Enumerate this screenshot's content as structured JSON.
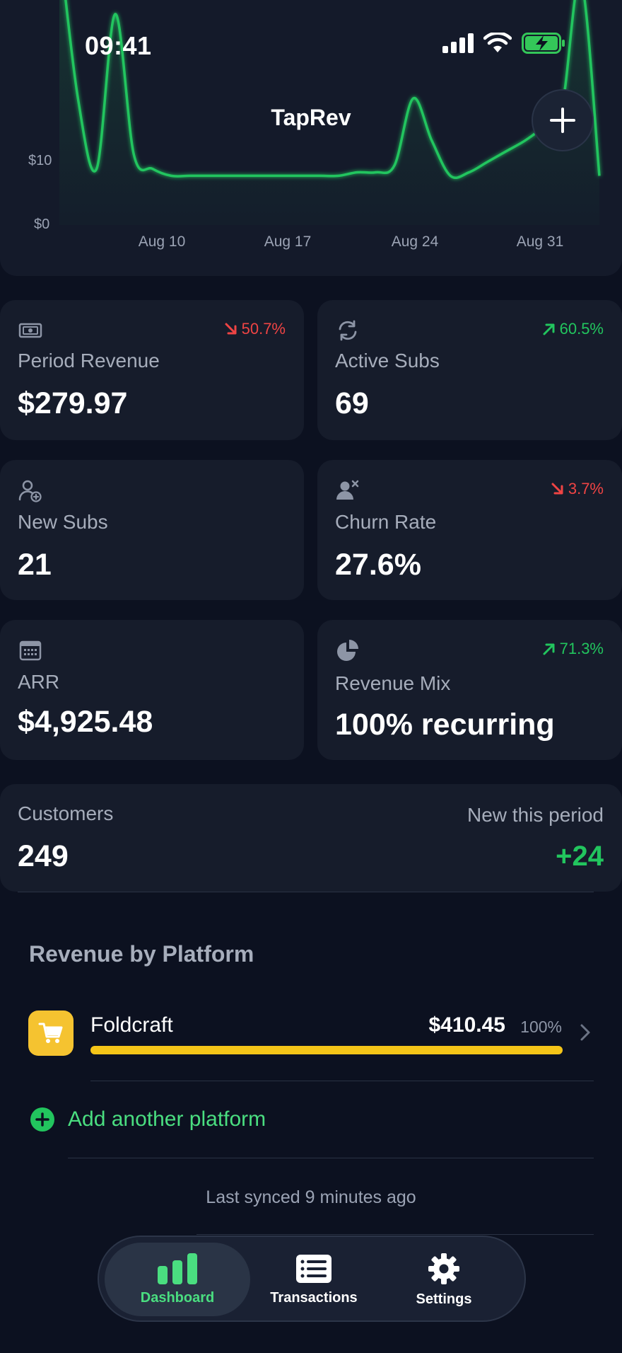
{
  "status_bar": {
    "time": "09:41",
    "icons": [
      "signal-icon",
      "wifi-icon",
      "battery-charging-icon"
    ]
  },
  "header": {
    "title": "TapRev",
    "add_icon": "plus-icon"
  },
  "chart_data": {
    "type": "area",
    "y_tick_labels": [
      "$0",
      "$10"
    ],
    "x_tick_labels": [
      "Aug 10",
      "Aug 17",
      "Aug 24",
      "Aug 31"
    ],
    "x": [
      "Aug 4",
      "Aug 5",
      "Aug 6",
      "Aug 7",
      "Aug 8",
      "Aug 9",
      "Aug 10",
      "Aug 11",
      "Aug 12",
      "Aug 13",
      "Aug 14",
      "Aug 15",
      "Aug 16",
      "Aug 17",
      "Aug 18",
      "Aug 19",
      "Aug 20",
      "Aug 21",
      "Aug 22",
      "Aug 23",
      "Aug 24",
      "Aug 25",
      "Aug 26",
      "Aug 27",
      "Aug 28",
      "Aug 29",
      "Aug 30",
      "Aug 31",
      "Sep 1",
      "Sep 2"
    ],
    "values": [
      40,
      18,
      8,
      30,
      10,
      8,
      7,
      7,
      7,
      7,
      7,
      7,
      7,
      7,
      7,
      7,
      7.5,
      7.5,
      8.5,
      18,
      12,
      7,
      7.5,
      9,
      10.5,
      12,
      14,
      17,
      35,
      7
    ],
    "ylim": [
      0,
      32
    ],
    "color": "#22c55e",
    "grid": false
  },
  "metrics": {
    "period_revenue": {
      "icon": "cash-icon",
      "change": "50.7%",
      "direction": "down",
      "label": "Period Revenue",
      "value": "$279.97"
    },
    "active_subs": {
      "icon": "refresh-icon",
      "change": "60.5%",
      "direction": "up",
      "label": "Active Subs",
      "value": "69"
    },
    "new_subs": {
      "icon": "user-add-icon",
      "label": "New Subs",
      "value": "21"
    },
    "churn_rate": {
      "icon": "user-remove-icon",
      "change": "3.7%",
      "direction": "down",
      "label": "Churn Rate",
      "value": "27.6%"
    },
    "arr": {
      "icon": "calendar-icon",
      "label": "ARR",
      "value": "$4,925.48"
    },
    "revenue_mix": {
      "icon": "pie-chart-icon",
      "change": "71.3%",
      "direction": "up",
      "label": "Revenue Mix",
      "value": "100% recurring"
    }
  },
  "customers": {
    "label": "Customers",
    "value": "249",
    "new_label": "New this period",
    "new_value": "+24"
  },
  "platforms": {
    "title": "Revenue by Platform",
    "items": [
      {
        "icon": "shopping-cart-icon",
        "name": "Foldcraft",
        "amount": "$410.45",
        "percent": "100%",
        "share": 1.0,
        "color": "#f5c518"
      }
    ],
    "add_label": "Add another platform"
  },
  "sync": {
    "text": "Last synced 9 minutes ago"
  },
  "tabs": [
    {
      "label": "Dashboard",
      "icon": "bar-chart-icon",
      "active": true
    },
    {
      "label": "Transactions",
      "icon": "list-icon",
      "active": false
    },
    {
      "label": "Settings",
      "icon": "gear-icon",
      "active": false
    }
  ],
  "colors": {
    "background": "#0c1120",
    "card": "#161c2b",
    "positive": "#22c55e",
    "negative": "#ef4444",
    "accent": "#4ade80"
  }
}
